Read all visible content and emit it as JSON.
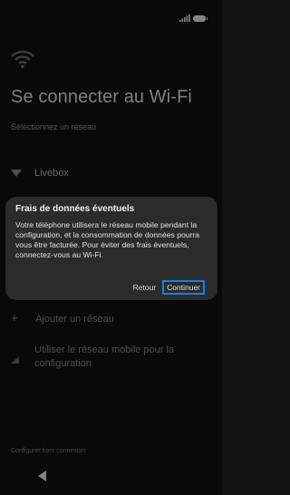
{
  "header": {
    "title": "Se connecter au Wi-Fi",
    "subtitle": "Sélectionnez un réseau"
  },
  "networks": [
    {
      "label": "Livebox"
    }
  ],
  "dialog": {
    "title": "Frais de données éventuels",
    "body": "Votre téléphone utilisera le réseau mobile pendant la configuration, et la consommation de données pourra vous être facturée. Pour éviter des frais éventuels, connectez-vous au Wi-Fi.",
    "secondary_label": "Retour",
    "primary_label": "Continuer"
  },
  "options": {
    "add_network": "Ajouter un réseau",
    "mobile_network_line1": "Utiliser le réseau mobile pour la",
    "mobile_network_line2": "configuration"
  },
  "footer": {
    "offline_link": "Configurer hors connexion"
  },
  "colors": {
    "background": "#121212",
    "dialog": "#2b2b2b",
    "focus_outline": "#1a7fe0"
  },
  "icons": [
    "signal-icon",
    "battery-icon",
    "wifi-icon",
    "add-icon",
    "cellular-icon",
    "back-icon"
  ]
}
